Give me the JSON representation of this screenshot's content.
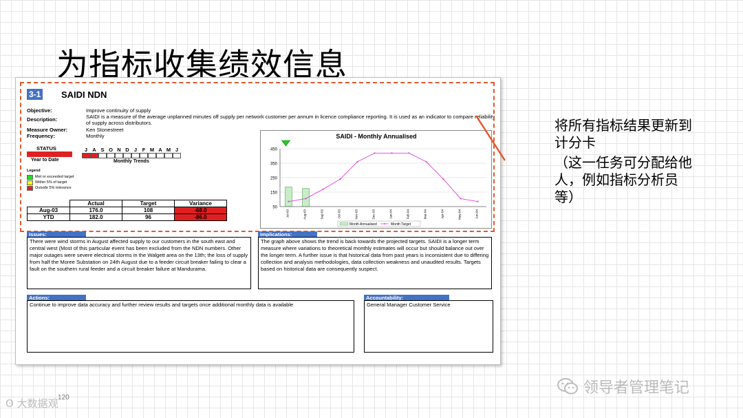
{
  "slide_title": "为指标收集绩效信息",
  "doc": {
    "kpi_code": "3-1",
    "kpi_name": "SAIDI NDN",
    "meta": [
      {
        "key": "Objective:",
        "value": "Improve continuity of supply"
      },
      {
        "key": "Description:",
        "value": "SAIDI is a measure of the average unplanned minutes off supply per network customer per annum in licence compliance reporting.  It is used as an indicator to compare reliability of supply across distributors."
      },
      {
        "key": "Measure Owner:",
        "value": "Ken Stonestreet"
      },
      {
        "key": "Frequency:",
        "value": "Monthly"
      }
    ],
    "status_label": "STATUS",
    "ytd_label": "Year to Date",
    "status_color": "#e02020",
    "months": [
      "J",
      "A",
      "S",
      "O",
      "N",
      "D",
      "J",
      "F",
      "M",
      "A",
      "M",
      "J"
    ],
    "months_filled": 2,
    "trend_label": "Monthly Trends",
    "legend": {
      "title": "Legend",
      "items": [
        {
          "label": "Met or exceeded target",
          "color": "#22dd22"
        },
        {
          "label": "Within 5% of target",
          "color": "#ffff00"
        },
        {
          "label": "Outside 5% tolerance",
          "color": "#e02020"
        }
      ]
    },
    "stats": {
      "headers": [
        "Actual",
        "Target",
        "Variance"
      ],
      "rows": [
        {
          "label": "Aug-03",
          "actual": "176.0",
          "target": "108",
          "variance": "-68.0"
        },
        {
          "label": "YTD",
          "actual": "182.0",
          "target": "96",
          "variance": "-86.0"
        }
      ]
    },
    "issues": {
      "title": "Issues:",
      "text": "There were wind storms in August affected supply to our customers in the south east and central west (Most of this particular event has been excluded from the NDN numbers. Other major outages were severe electrical storms in the Walgett area on the 13th; the loss of supply from half the Moree Substation on 24th August due to a feeder circuit breaker failing to clear a fault on the southern rural feeder and a circuit breaker failure at Mandurama."
    },
    "implications": {
      "title": "Implications:",
      "text": "The graph above shows the trend is back towards the projected targets. SAIDI is a longer term measure where variations to theoretical monthly estimates will occur but should balance out over the longer term. A further issue is that historical data from past years is inconsistent due to differing collection and analysis methodologies, data collection weakness and unaudited results. Targets based on historical data are consequently suspect."
    },
    "actions": {
      "title": "Actions:",
      "text": "Continue to improve data accuracy and further review results and targets once additional monthly data is available"
    },
    "accountability": {
      "title": "Accountability:",
      "text": "General Manager Customer Service"
    }
  },
  "chart_data": {
    "type": "bar",
    "title": "SAIDI - Monthly Annualised",
    "categories": [
      "Jul-03",
      "Aug-03",
      "Sep-03",
      "Oct-03",
      "Nov-03",
      "Dec-03",
      "Jan-04",
      "Feb-04",
      "Mar-04",
      "Apr-04",
      "May-04",
      "Jun-04"
    ],
    "series": [
      {
        "name": "Month Annualised",
        "type": "bar",
        "color": "#c6efc6",
        "values": [
          185,
          175,
          null,
          null,
          null,
          null,
          null,
          null,
          null,
          null,
          null,
          null
        ]
      },
      {
        "name": "Month Target",
        "type": "line",
        "color": "#dd44dd",
        "values": [
          85,
          105,
          170,
          240,
          360,
          420,
          420,
          420,
          360,
          240,
          105,
          85
        ]
      }
    ],
    "yticks": [
      50,
      150,
      250,
      350,
      450
    ],
    "ylim": [
      50,
      450
    ],
    "grid": true,
    "legend_position": "bottom",
    "flag_color": "#22cc22"
  },
  "side_note": {
    "lines": [
      "将所有指标结果更新到",
      "计分卡",
      " （这一任务可分配给他",
      "人，例如指标分析员",
      "等）"
    ]
  },
  "annotation_line_color": "#e2582c",
  "page_number": "120",
  "watermark_left": "大数据观",
  "watermark_right": "领导者管理笔记"
}
